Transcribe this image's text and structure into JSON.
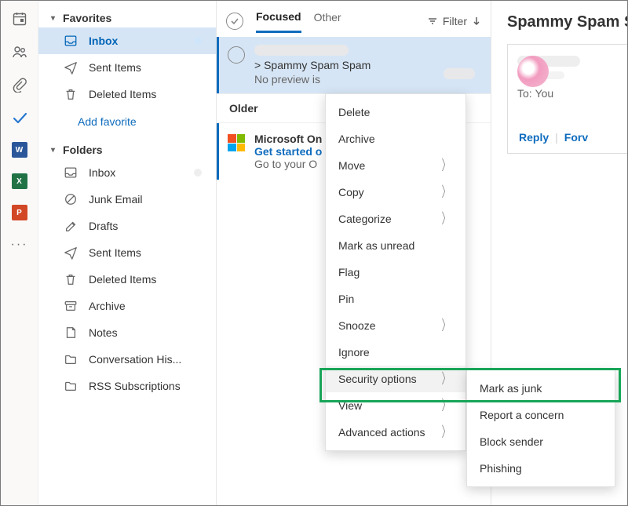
{
  "rail": {
    "items": [
      {
        "name": "calendar-icon",
        "glyph": "cal"
      },
      {
        "name": "people-icon",
        "glyph": "people"
      },
      {
        "name": "attach-icon",
        "glyph": "clip"
      },
      {
        "name": "todo-icon",
        "glyph": "check"
      },
      {
        "name": "word-icon",
        "label": "W",
        "color": "#2b579a"
      },
      {
        "name": "excel-icon",
        "label": "X",
        "color": "#217346"
      },
      {
        "name": "powerpoint-icon",
        "label": "P",
        "color": "#d24726"
      },
      {
        "name": "more-icon",
        "glyph": "more"
      }
    ]
  },
  "sidebar": {
    "favorites_label": "Favorites",
    "favorites": [
      {
        "icon": "inbox",
        "label": "Inbox",
        "selected": true,
        "dot": true
      },
      {
        "icon": "sent",
        "label": "Sent Items"
      },
      {
        "icon": "trash",
        "label": "Deleted Items"
      }
    ],
    "add_favorite_label": "Add favorite",
    "folders_label": "Folders",
    "folders": [
      {
        "icon": "inbox",
        "label": "Inbox",
        "dot": true
      },
      {
        "icon": "junk",
        "label": "Junk Email"
      },
      {
        "icon": "drafts",
        "label": "Drafts"
      },
      {
        "icon": "sent",
        "label": "Sent Items"
      },
      {
        "icon": "trash",
        "label": "Deleted Items"
      },
      {
        "icon": "archive",
        "label": "Archive"
      },
      {
        "icon": "notes",
        "label": "Notes"
      },
      {
        "icon": "folder",
        "label": "Conversation His..."
      },
      {
        "icon": "folder",
        "label": "RSS Subscriptions"
      }
    ]
  },
  "list": {
    "tabs": {
      "focused": "Focused",
      "other": "Other"
    },
    "filter_label": "Filter",
    "selected_msg": {
      "subject_prefix": ">",
      "subject": "Spammy Spam Spam",
      "preview": "No preview is"
    },
    "older_label": "Older",
    "ms_msg": {
      "sender": "Microsoft On",
      "subject": "Get started o",
      "preview": "Go to your O"
    }
  },
  "context_menu": [
    {
      "label": "Delete"
    },
    {
      "label": "Archive"
    },
    {
      "label": "Move",
      "arrow": true
    },
    {
      "label": "Copy",
      "arrow": true
    },
    {
      "label": "Categorize",
      "arrow": true
    },
    {
      "label": "Mark as unread"
    },
    {
      "label": "Flag"
    },
    {
      "label": "Pin"
    },
    {
      "label": "Snooze",
      "arrow": true
    },
    {
      "label": "Ignore"
    },
    {
      "label": "Security options",
      "arrow": true,
      "hi": true
    },
    {
      "label": "View",
      "arrow": true
    },
    {
      "label": "Advanced actions",
      "arrow": true
    }
  ],
  "submenu": [
    {
      "label": "Mark as junk"
    },
    {
      "label": "Report a concern"
    },
    {
      "label": "Block sender"
    },
    {
      "label": "Phishing"
    }
  ],
  "reading": {
    "title": "Spammy Spam S",
    "to_label": "To:",
    "to_value": "You",
    "reply_label": "Reply",
    "forward_label": "Forv"
  }
}
